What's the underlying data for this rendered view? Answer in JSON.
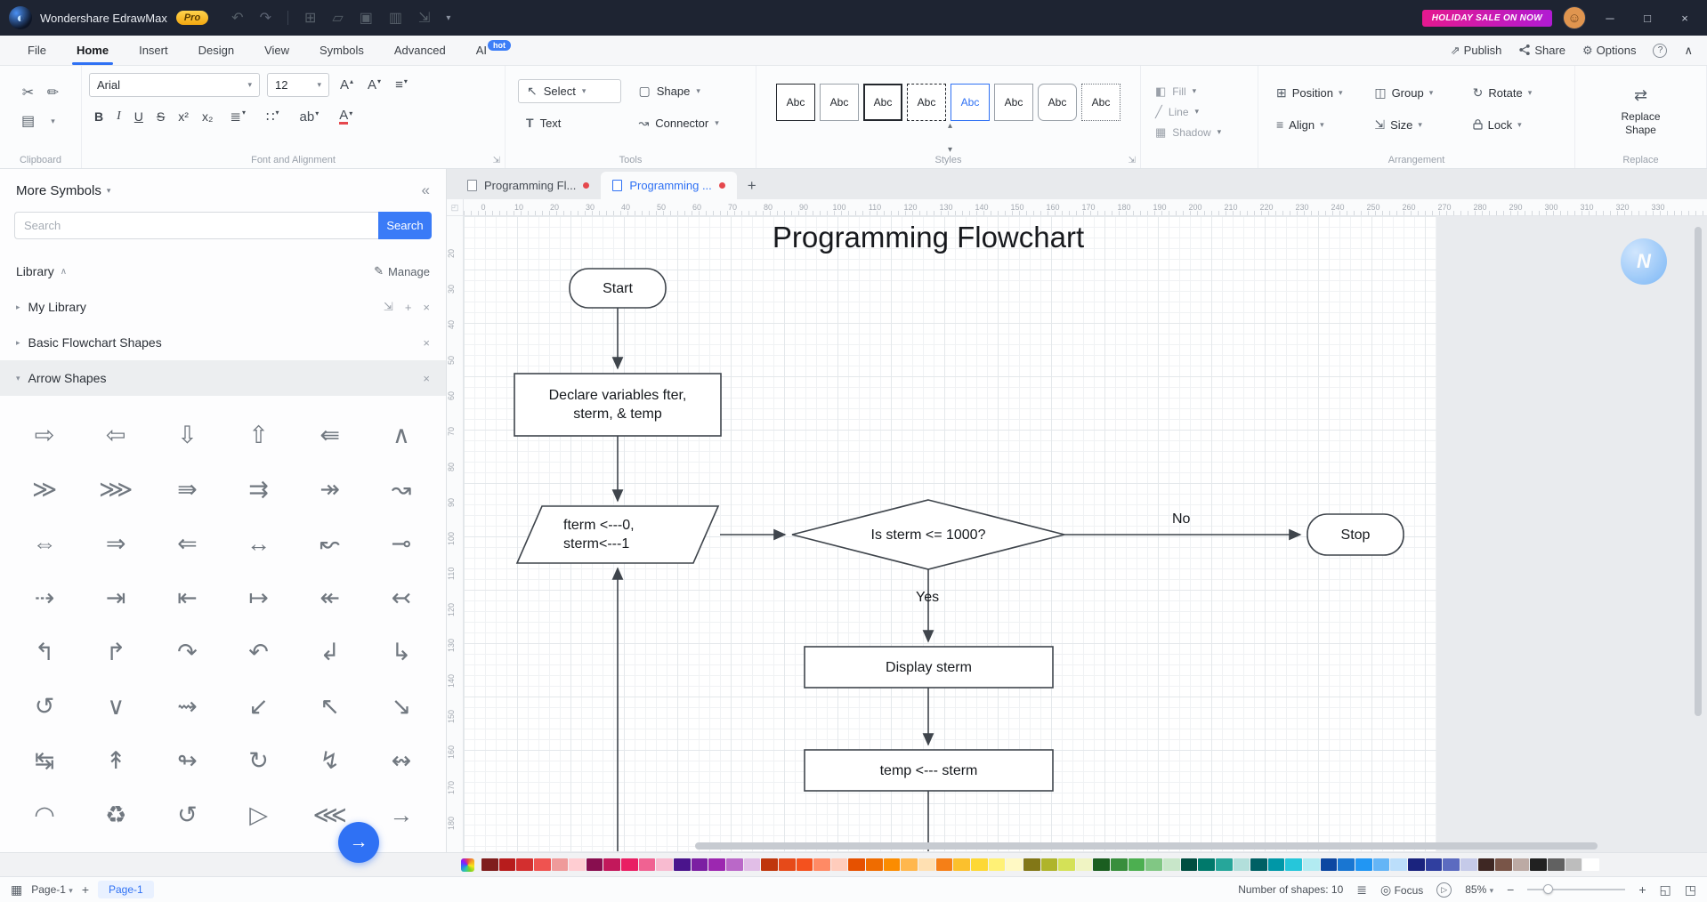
{
  "titlebar": {
    "app_title": "Wondershare EdrawMax",
    "pro_badge": "Pro",
    "sale_badge": "HOLIDAY SALE ON NOW"
  },
  "menubar": {
    "items": [
      {
        "label": "File"
      },
      {
        "label": "Home"
      },
      {
        "label": "Insert"
      },
      {
        "label": "Design"
      },
      {
        "label": "View"
      },
      {
        "label": "Symbols"
      },
      {
        "label": "Advanced"
      },
      {
        "label": "AI"
      }
    ],
    "hot_badge": "hot",
    "publish": "Publish",
    "share": "Share",
    "options": "Options",
    "help": "?"
  },
  "ribbon": {
    "font_name": "Arial",
    "font_size": "12",
    "font_letter": "A",
    "bold": "B",
    "italic": "I",
    "underline": "U",
    "strike": "S",
    "superscript": "x²",
    "subscript": "x₂",
    "highlight": "ab",
    "font_color": "A",
    "select_label": "Select",
    "shape_label": "Shape",
    "text_label": "Text",
    "connector_label": "Connector",
    "styles": [
      "Abc",
      "Abc",
      "Abc",
      "Abc",
      "Abc",
      "Abc",
      "Abc",
      "Abc"
    ],
    "fill_label": "Fill",
    "line_label": "Line",
    "shadow_label": "Shadow",
    "position_label": "Position",
    "group_label": "Group",
    "rotate_label": "Rotate",
    "align_label": "Align",
    "size_label": "Size",
    "lock_label": "Lock",
    "replace_label": "Replace Shape",
    "groups": {
      "clipboard": "Clipboard",
      "font": "Font and Alignment",
      "tools": "Tools",
      "styles": "Styles",
      "arrangement": "Arrangement",
      "replace": "Replace"
    }
  },
  "sidebar": {
    "title": "More Symbols",
    "search_placeholder": "Search",
    "search_button": "Search",
    "library_label": "Library",
    "manage_label": "Manage",
    "my_library": "My Library",
    "basic_shapes": "Basic Flowchart Shapes",
    "arrow_shapes": "Arrow Shapes",
    "arrow_glyphs": [
      "⇨",
      "⇦",
      "⇩",
      "⇧",
      "⇚",
      "∧",
      "≫",
      "⋙",
      "⇛",
      "⇉",
      "↠",
      "↝",
      "⇔",
      "⇒",
      "⇐",
      "↔",
      "↜",
      "⊸",
      "⇢",
      "⇥",
      "⇤",
      "↦",
      "↞",
      "↢",
      "↰",
      "↱",
      "↷",
      "↶",
      "↲",
      "↳",
      "↺",
      "∨",
      "⇝",
      "↙",
      "↖",
      "↘",
      "↹",
      "↟",
      "↬",
      "↻",
      "↯",
      "↭",
      "◠",
      "♻",
      "↺",
      "▷",
      "⋘",
      "→"
    ]
  },
  "doc_tabs": {
    "tabs": [
      {
        "label": "Programming Fl..."
      },
      {
        "label": "Programming ..."
      }
    ]
  },
  "rulers": {
    "horizontal": [
      "0",
      "10",
      "20",
      "30",
      "40",
      "50",
      "60",
      "70",
      "80",
      "90",
      "100",
      "110",
      "120",
      "130",
      "140",
      "150",
      "160",
      "170",
      "180",
      "190",
      "200",
      "210",
      "220",
      "230",
      "240",
      "250",
      "260",
      "270",
      "280",
      "290",
      "300",
      "310",
      "320",
      "330"
    ],
    "vertical": [
      "20",
      "30",
      "40",
      "50",
      "60",
      "70",
      "80",
      "90",
      "100",
      "110",
      "120",
      "130",
      "140",
      "150",
      "160",
      "170",
      "180"
    ]
  },
  "canvas": {
    "title": "Programming Flowchart",
    "nodes": {
      "start": "Start",
      "declare": "Declare variables fter,\nsterm, & temp",
      "init": "fterm <---0,\nsterm<---1",
      "decision": "Is sterm <= 1000?",
      "stop": "Stop",
      "display": "Display sterm",
      "temp": "temp <--- sterm"
    },
    "labels": {
      "yes": "Yes",
      "no": "No"
    }
  },
  "colorbar": {
    "colors": [
      "#7f1d1d",
      "#b71c1c",
      "#d32f2f",
      "#ef5350",
      "#ef9a9a",
      "#ffcdd2",
      "#880e4f",
      "#c2185b",
      "#e91e63",
      "#f06292",
      "#f8bbd0",
      "#4a148c",
      "#7b1fa2",
      "#9c27b0",
      "#ba68c8",
      "#e1bee7",
      "#bf360c",
      "#e64a19",
      "#f4511e",
      "#ff8a65",
      "#ffccbc",
      "#e65100",
      "#ef6c00",
      "#fb8c00",
      "#ffb74d",
      "#ffe0b2",
      "#f57f17",
      "#fbc02d",
      "#fdd835",
      "#fff176",
      "#fff9c4",
      "#827717",
      "#afb42b",
      "#d4e157",
      "#f0f4c3",
      "#1b5e20",
      "#388e3c",
      "#4caf50",
      "#81c784",
      "#c8e6c9",
      "#004d40",
      "#00796b",
      "#26a69a",
      "#b2dfdb",
      "#006064",
      "#0097a7",
      "#26c6da",
      "#b2ebf2",
      "#0d47a1",
      "#1976d2",
      "#2196f3",
      "#64b5f6",
      "#bbdefb",
      "#1a237e",
      "#303f9f",
      "#5c6bc0",
      "#c5cae9",
      "#3e2723",
      "#795548",
      "#bcaaa4",
      "#212121",
      "#616161",
      "#bdbdbd",
      "#ffffff"
    ]
  },
  "statusbar": {
    "page_selector": "Page-1",
    "page_tab": "Page-1",
    "shapes_count": "Number of shapes: 10",
    "focus_label": "Focus",
    "zoom_value": "85%"
  },
  "icons": {
    "logo": "◐",
    "undo": "↶",
    "redo": "↷",
    "new": "⊞",
    "open": "▱",
    "save": "▣",
    "print": "▥",
    "export": "⇲",
    "caret_down": "▾",
    "caret_up": "▴",
    "caret_right": "▸",
    "chevron_up": "∧",
    "minimize": "─",
    "maximize": "□",
    "close": "×",
    "gear": "⚙",
    "publish": "⇗",
    "cut": "✂",
    "painter": "✏",
    "paste": "▤",
    "cursor": "↖",
    "shape_square": "▢",
    "connector": "↝",
    "fill": "◧",
    "line": "╱",
    "shadow": "▦",
    "position": "⊞",
    "group": "◫",
    "rotate": "↻",
    "align": "≡",
    "size": "⇲",
    "replace": "⇄",
    "line_spacing": "≣",
    "list": "∷",
    "collapse": "«",
    "close_x": "×",
    "plus": "+",
    "manage": "✎",
    "import": "⇲",
    "pages": "▦",
    "layers": "≣",
    "focus": "◎",
    "play": "▷",
    "fullscreen": "◱",
    "fit": "◳",
    "minus": "−",
    "next": "→",
    "watermark": "N",
    "ruler_corner": "◰",
    "expand": "⇲"
  }
}
